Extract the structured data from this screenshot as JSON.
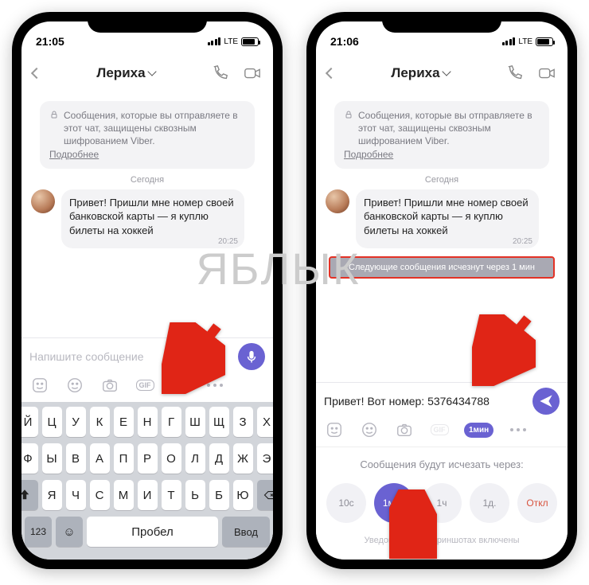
{
  "watermark": "ЯБЛЫК",
  "left": {
    "time": "21:05",
    "net": "LTE",
    "contact": "Лериха",
    "encryption": "Сообщения, которые вы отправляете в этот чат, защищены сквозным шифрованием Viber.",
    "enc_more": "Подробнее",
    "date": "Сегодня",
    "message": "Привет! Пришли мне номер своей банковской карты — я куплю билеты на хоккей",
    "msg_time": "20:25",
    "placeholder": "Напишите сообщение",
    "gif_label": "GIF",
    "kb": {
      "r1": [
        "Й",
        "Ц",
        "У",
        "К",
        "Е",
        "Н",
        "Г",
        "Ш",
        "Щ",
        "З",
        "Х"
      ],
      "r2": [
        "Ф",
        "Ы",
        "В",
        "А",
        "П",
        "Р",
        "О",
        "Л",
        "Д",
        "Ж",
        "Э"
      ],
      "r3": [
        "Я",
        "Ч",
        "С",
        "М",
        "И",
        "Т",
        "Ь",
        "Б",
        "Ю"
      ],
      "digits": "123",
      "space": "Пробел",
      "enter": "Ввод"
    }
  },
  "right": {
    "time": "21:06",
    "net": "LTE",
    "contact": "Лериха",
    "encryption": "Сообщения, которые вы отправляете в этот чат, защищены сквозным шифрованием Viber.",
    "enc_more": "Подробнее",
    "date": "Сегодня",
    "message": "Привет! Пришли мне номер своей банковской карты — я куплю билеты на хоккей",
    "msg_time": "20:25",
    "banner": "Следующие сообщения исчезнут через 1 мин",
    "input_value": "Привет! Вот номер: 5376434788",
    "timer_label": "1мин",
    "panel_title": "Сообщения будут исчезать через:",
    "opts": [
      "10с",
      "1мин",
      "1ч",
      "1д.",
      "Откл"
    ],
    "panel_foot": "Уведомления о скриншотах включены"
  }
}
